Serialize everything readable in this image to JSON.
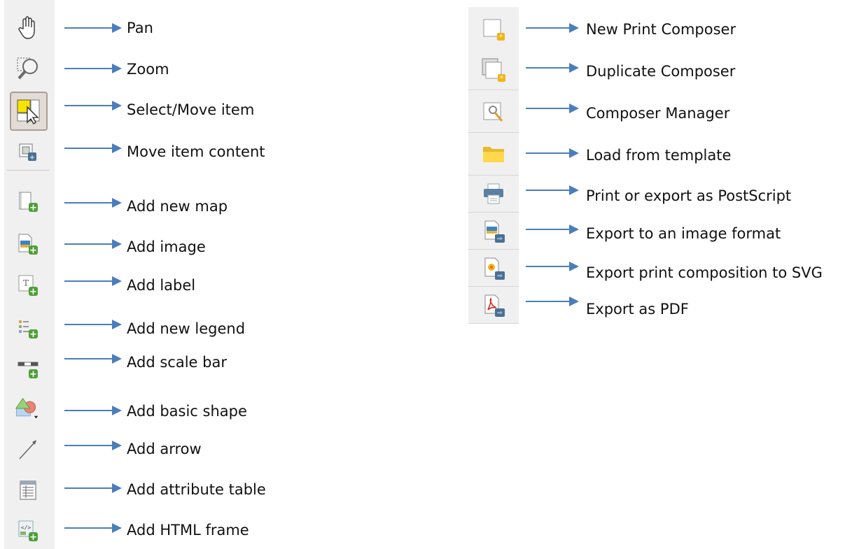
{
  "left_tools": [
    {
      "label": "Pan",
      "icon": "hand-icon"
    },
    {
      "label": "Zoom",
      "icon": "zoom-icon"
    },
    {
      "label": "Select/Move item",
      "icon": "select-move-icon"
    },
    {
      "label": "Move item content",
      "icon": "move-content-icon"
    },
    {
      "label": "Add new map",
      "icon": "add-map-icon"
    },
    {
      "label": "Add image",
      "icon": "add-image-icon"
    },
    {
      "label": "Add label",
      "icon": "add-label-icon"
    },
    {
      "label": "Add new legend",
      "icon": "add-legend-icon"
    },
    {
      "label": "Add scale bar",
      "icon": "add-scalebar-icon"
    },
    {
      "label": "Add basic shape",
      "icon": "add-shape-icon"
    },
    {
      "label": "Add arrow",
      "icon": "add-arrow-icon"
    },
    {
      "label": "Add attribute table",
      "icon": "add-table-icon"
    },
    {
      "label": "Add HTML frame",
      "icon": "add-html-icon"
    }
  ],
  "right_tools": [
    {
      "label": "New Print Composer",
      "icon": "new-composer-icon"
    },
    {
      "label": "Duplicate Composer",
      "icon": "duplicate-composer-icon"
    },
    {
      "label": "Composer Manager",
      "icon": "composer-manager-icon"
    },
    {
      "label": "Load from template",
      "icon": "folder-icon"
    },
    {
      "label": "Print or export as PostScript",
      "icon": "printer-icon"
    },
    {
      "label": "Export to an image format",
      "icon": "export-image-icon"
    },
    {
      "label": "Export print composition to SVG",
      "icon": "export-svg-icon"
    },
    {
      "label": "Export as PDF",
      "icon": "export-pdf-icon"
    }
  ],
  "colors": {
    "arrow": "#4a7ebb",
    "plus_badge": "#4f9f3a",
    "export_badge": "#4a6f94",
    "star_badge": "#f2b519"
  }
}
